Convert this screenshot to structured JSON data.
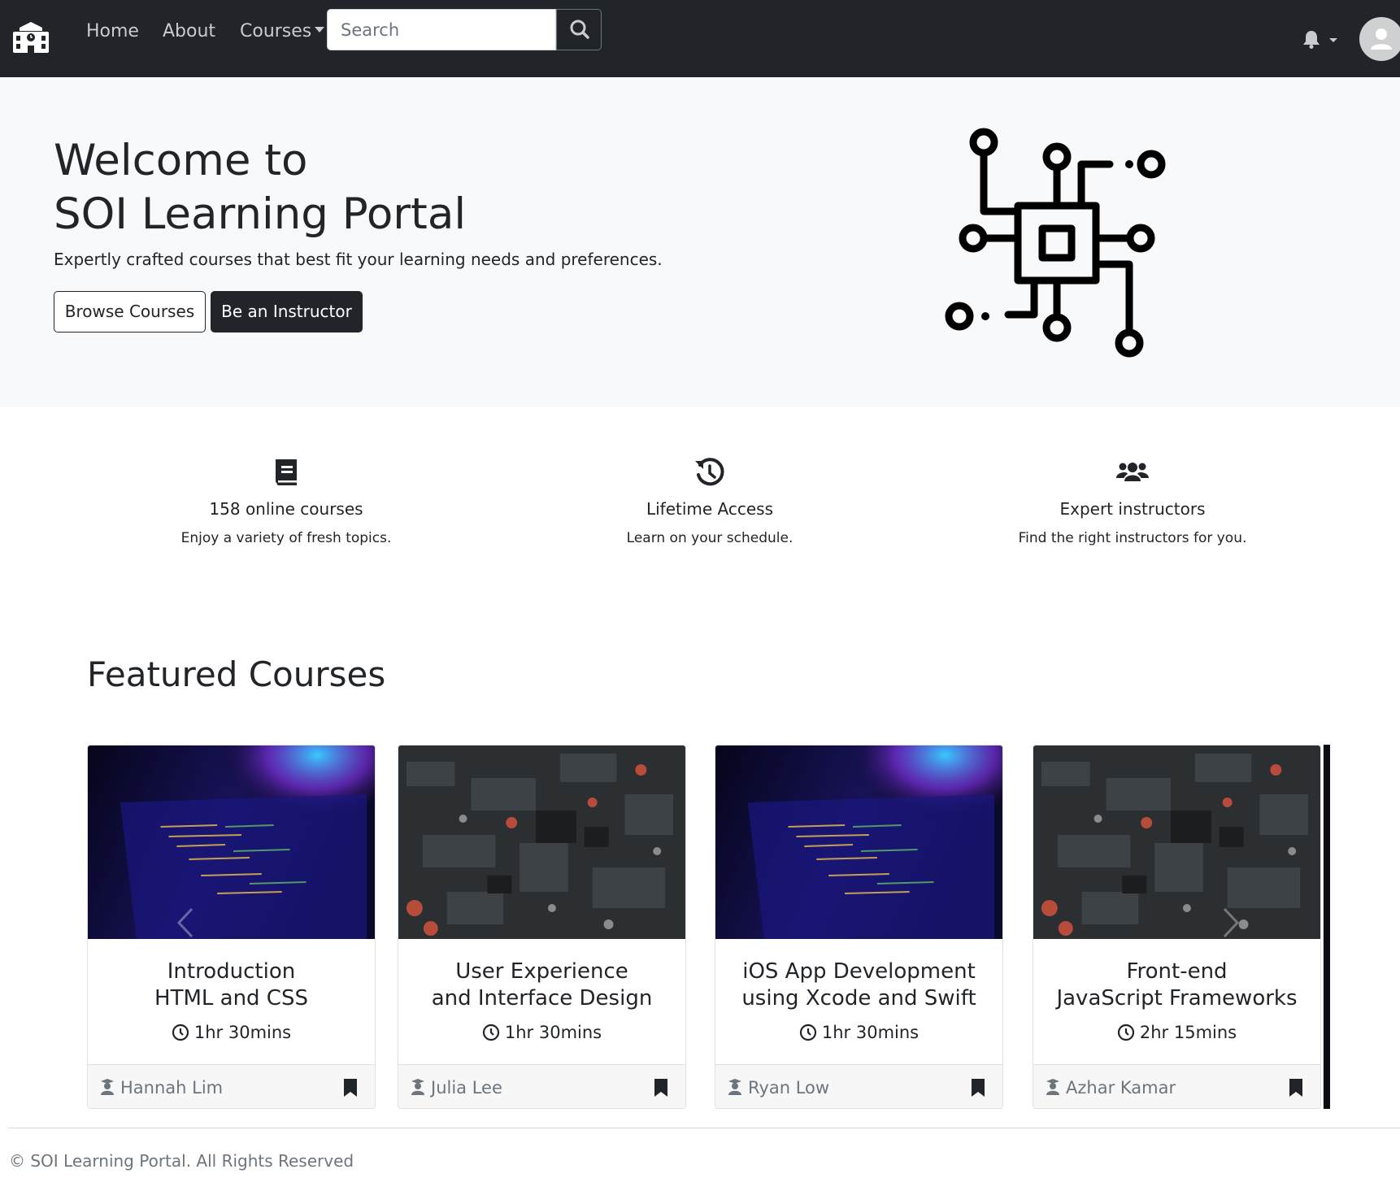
{
  "nav": {
    "links": [
      "Home",
      "About",
      "Courses"
    ],
    "search_placeholder": "Search"
  },
  "hero": {
    "title_line1": "Welcome to",
    "title_line2": "SOI Learning Portal",
    "subtitle": "Expertly crafted courses that best fit your learning needs and preferences.",
    "browse_label": "Browse Courses",
    "instructor_label": "Be an Instructor"
  },
  "features": [
    {
      "icon": "book-icon",
      "title": "158 online courses",
      "desc": "Enjoy a variety of fresh topics."
    },
    {
      "icon": "history-icon",
      "title": "Lifetime Access",
      "desc": "Learn on your schedule."
    },
    {
      "icon": "users-icon",
      "title": "Expert instructors",
      "desc": "Find the right instructors for you."
    }
  ],
  "featured": {
    "title": "Featured Courses",
    "courses": [
      {
        "title_line1": "Introduction",
        "title_line2": "HTML and CSS",
        "duration": "1hr 30mins",
        "instructor": "Hannah Lim",
        "image": "laptop-code-image"
      },
      {
        "title_line1": "User Experience",
        "title_line2": "and Interface Design",
        "duration": "1hr 30mins",
        "instructor": "Julia Lee",
        "image": "circuit-board-image"
      },
      {
        "title_line1": "iOS App Development",
        "title_line2": "using Xcode and Swift",
        "duration": "1hr 30mins",
        "instructor": "Ryan Low",
        "image": "laptop-code-image"
      },
      {
        "title_line1": "Front-end",
        "title_line2": "JavaScript Frameworks",
        "duration": "2hr 15mins",
        "instructor": "Azhar Kamar",
        "image": "circuit-board-image"
      }
    ]
  },
  "footer": {
    "text": "© SOI Learning Portal. All Rights Reserved"
  },
  "colors": {
    "navbar": "#212529",
    "hero_bg": "#f8f9fa",
    "text": "#212529",
    "muted": "#6c757d"
  }
}
